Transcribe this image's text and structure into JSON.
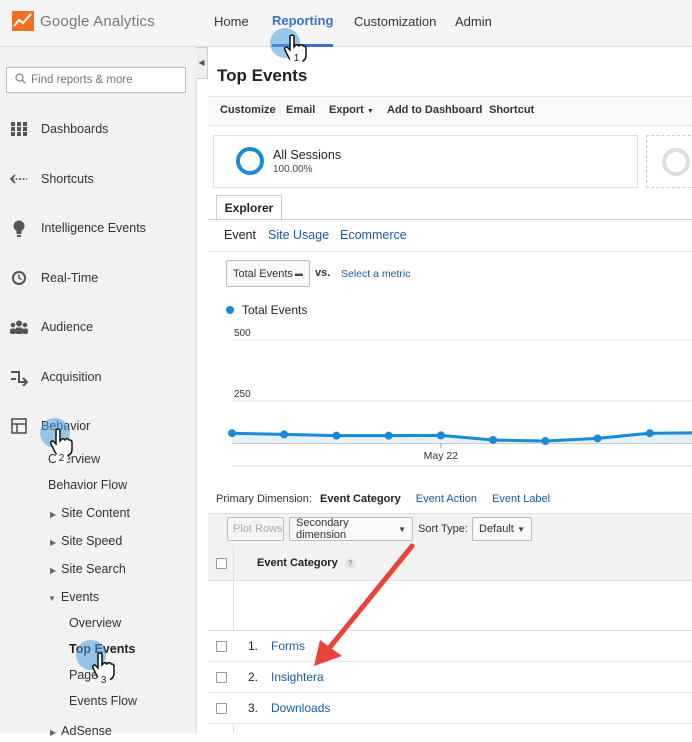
{
  "header": {
    "logo_text": "Google Analytics",
    "tabs": [
      {
        "label": "Home",
        "active": false
      },
      {
        "label": "Reporting",
        "active": true
      },
      {
        "label": "Customization",
        "active": false
      },
      {
        "label": "Admin",
        "active": false
      }
    ]
  },
  "sidebar": {
    "search_placeholder": "Find reports & more",
    "items": [
      {
        "label": "Dashboards",
        "icon": "grid-icon"
      },
      {
        "label": "Shortcuts",
        "icon": "shortcut-arrow-icon"
      },
      {
        "label": "Intelligence Events",
        "icon": "lightbulb-icon"
      },
      {
        "label": "Real-Time",
        "icon": "clock-icon"
      },
      {
        "label": "Audience",
        "icon": "people-icon"
      },
      {
        "label": "Acquisition",
        "icon": "acquisition-arrows-icon"
      },
      {
        "label": "Behavior",
        "icon": "layout-icon"
      }
    ],
    "behavior_sub": {
      "overview": "Overview",
      "behavior_flow": "Behavior Flow",
      "site_content": "Site Content",
      "site_speed": "Site Speed",
      "site_search": "Site Search",
      "events": "Events",
      "events_sub": [
        "Overview",
        "Top Events",
        "Pages",
        "Events Flow"
      ],
      "adsense": "AdSense"
    }
  },
  "report": {
    "title": "Top Events",
    "toolbar": [
      "Customize",
      "Email",
      "Export",
      "Add to Dashboard",
      "Shortcut"
    ],
    "segment": {
      "name": "All Sessions",
      "percent": "100.00%"
    },
    "explorer_tab": "Explorer",
    "subtabs": [
      "Event",
      "Site Usage",
      "Ecommerce"
    ],
    "metric_dropdown": "Total Events",
    "vs_label": "vs.",
    "select_metric": "Select a metric",
    "primary_dimension": {
      "label": "Primary Dimension:",
      "options": [
        "Event Category",
        "Event Action",
        "Event Label"
      ]
    },
    "plot_rows": "Plot Rows",
    "secondary_dimension": "Secondary dimension",
    "sort_type_label": "Sort Type:",
    "sort_type_value": "Default",
    "column_header": "Event Category",
    "help_icon": "?",
    "rows": [
      {
        "num": "1.",
        "label": "Forms"
      },
      {
        "num": "2.",
        "label": "Insightera"
      },
      {
        "num": "3.",
        "label": "Downloads"
      }
    ]
  },
  "callouts": [
    "1",
    "2",
    "3"
  ],
  "colors": {
    "accent": "#3b6ed6",
    "line": "#1a8ad4",
    "arrow": "#e8443a",
    "callout": "#4a9ede"
  },
  "chart_data": {
    "type": "area",
    "series": [
      {
        "name": "Total Events",
        "values": [
          118,
          113,
          108,
          108,
          109,
          90,
          86,
          97,
          118,
          120
        ]
      }
    ],
    "x_tick_labels": [
      {
        "label": "May 22",
        "index": 4
      }
    ],
    "y_ticks": [
      250,
      500
    ],
    "legend": "top-left",
    "grid": true
  }
}
